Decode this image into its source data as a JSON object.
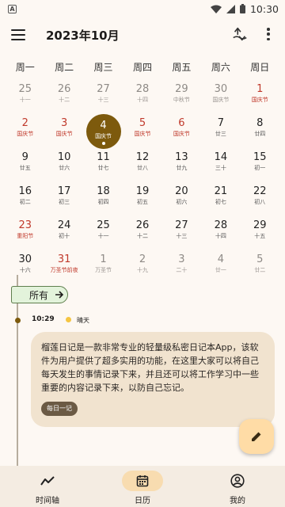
{
  "status_bar": {
    "time": "10:30",
    "left_badge": "A"
  },
  "app_bar": {
    "title": "2023年10月",
    "menu_icon": "menu-icon",
    "switch_icon": "switch-icon",
    "more_icon": "more-vert-icon"
  },
  "calendar": {
    "weekdays": [
      "周一",
      "周二",
      "周三",
      "周四",
      "周五",
      "周六",
      "周日"
    ],
    "days": [
      {
        "num": "25",
        "sub": "十一",
        "other": true
      },
      {
        "num": "26",
        "sub": "十二",
        "other": true
      },
      {
        "num": "27",
        "sub": "十三",
        "other": true
      },
      {
        "num": "28",
        "sub": "十四",
        "other": true
      },
      {
        "num": "29",
        "sub": "中秋节",
        "other": true
      },
      {
        "num": "30",
        "sub": "国庆节",
        "other": true
      },
      {
        "num": "1",
        "sub": "国庆节",
        "holiday": true
      },
      {
        "num": "2",
        "sub": "国庆节",
        "holiday": true
      },
      {
        "num": "3",
        "sub": "国庆节",
        "holiday": true
      },
      {
        "num": "4",
        "sub": "国庆节",
        "selected": true
      },
      {
        "num": "5",
        "sub": "国庆节",
        "holiday": true
      },
      {
        "num": "6",
        "sub": "国庆节",
        "holiday": true
      },
      {
        "num": "7",
        "sub": "廿三"
      },
      {
        "num": "8",
        "sub": "廿四"
      },
      {
        "num": "9",
        "sub": "廿五"
      },
      {
        "num": "10",
        "sub": "廿六"
      },
      {
        "num": "11",
        "sub": "廿七"
      },
      {
        "num": "12",
        "sub": "廿八"
      },
      {
        "num": "13",
        "sub": "廿九"
      },
      {
        "num": "14",
        "sub": "三十"
      },
      {
        "num": "15",
        "sub": "初一"
      },
      {
        "num": "16",
        "sub": "初二"
      },
      {
        "num": "17",
        "sub": "初三"
      },
      {
        "num": "18",
        "sub": "初四"
      },
      {
        "num": "19",
        "sub": "初五"
      },
      {
        "num": "20",
        "sub": "初六"
      },
      {
        "num": "21",
        "sub": "初七"
      },
      {
        "num": "22",
        "sub": "初八"
      },
      {
        "num": "23",
        "sub": "重阳节",
        "holiday": true
      },
      {
        "num": "24",
        "sub": "初十"
      },
      {
        "num": "25",
        "sub": "十一"
      },
      {
        "num": "26",
        "sub": "十二"
      },
      {
        "num": "27",
        "sub": "十三"
      },
      {
        "num": "28",
        "sub": "十四"
      },
      {
        "num": "29",
        "sub": "十五"
      },
      {
        "num": "30",
        "sub": "十六"
      },
      {
        "num": "31",
        "sub": "万圣节前夜",
        "holiday": true
      },
      {
        "num": "1",
        "sub": "万圣节",
        "other": true
      },
      {
        "num": "2",
        "sub": "十九",
        "other": true
      },
      {
        "num": "3",
        "sub": "二十",
        "other": true
      },
      {
        "num": "4",
        "sub": "廿一",
        "other": true
      },
      {
        "num": "5",
        "sub": "廿二",
        "other": true
      }
    ]
  },
  "timeline": {
    "filter_label": "所有",
    "entry": {
      "time": "10:29",
      "weather": "晴天",
      "text": "榴莲日记是一款非常专业的轻量级私密日记本App，该软件为用户提供了超多实用的功能，在这里大家可以将自己每天发生的事情记录下来，并且还可以将工作学习中一些重要的内容记录下来，以防自己忘记。",
      "tag": "每日一记"
    }
  },
  "bottom_nav": {
    "items": [
      {
        "label": "时间轴",
        "icon": "timeline-icon"
      },
      {
        "label": "日历",
        "icon": "calendar-icon"
      },
      {
        "label": "我的",
        "icon": "account-icon"
      }
    ]
  },
  "colors": {
    "accent": "#7d5a0d",
    "holiday": "#c0392b",
    "card": "#f1e3cf",
    "chip_bg": "#e3f3db",
    "fab": "#ffdca6",
    "weather_dot": "#f5c542"
  }
}
